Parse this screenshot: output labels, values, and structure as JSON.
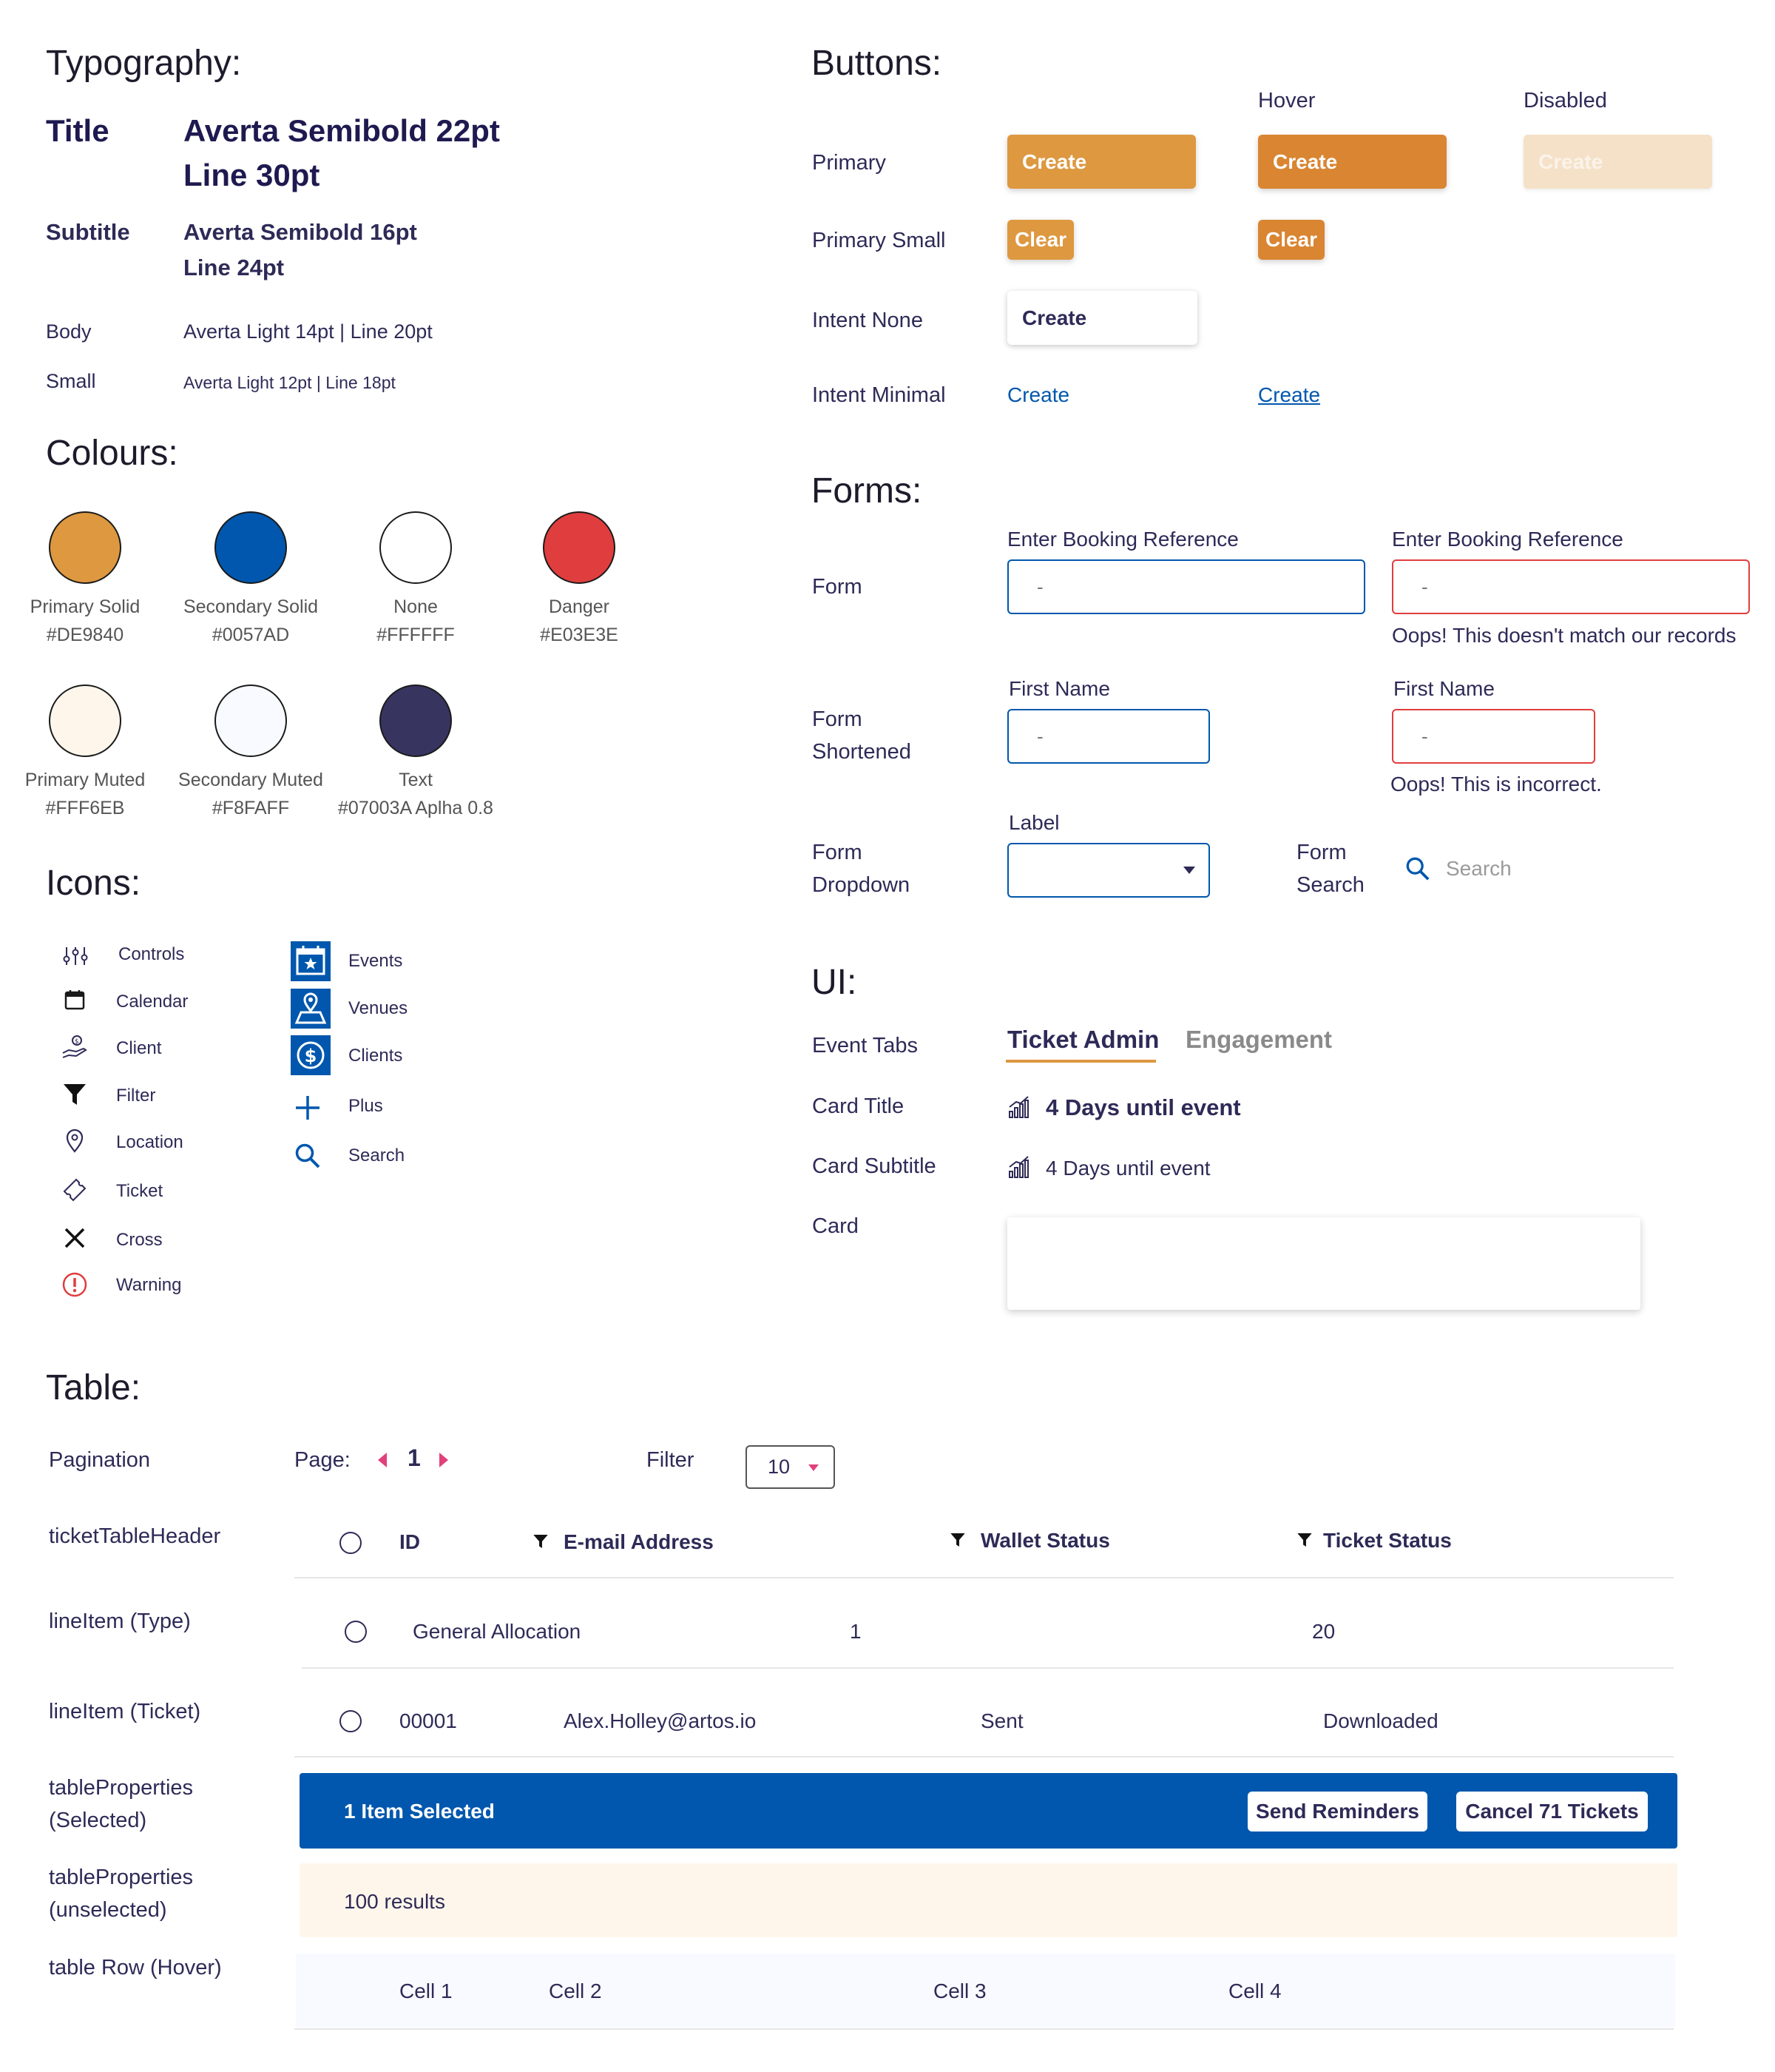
{
  "typography": {
    "heading": "Typography:",
    "title_label": "Title",
    "title_spec_1": "Averta Semibold 22pt",
    "title_spec_2": "Line 30pt",
    "subtitle_label": "Subtitle",
    "subtitle_spec_1": "Averta Semibold 16pt",
    "subtitle_spec_2": "Line 24pt",
    "body_label": "Body",
    "body_spec": "Averta Light 14pt | Line 20pt",
    "small_label": "Small",
    "small_spec": "Averta Light 12pt | Line 18pt"
  },
  "colours": {
    "heading": "Colours:",
    "swatches": [
      {
        "name": "Primary Solid",
        "hex": "#DE9840",
        "color": "#DE9840"
      },
      {
        "name": "Secondary Solid",
        "hex": "#0057AD",
        "color": "#0057AD"
      },
      {
        "name": "None",
        "hex": "#FFFFFF",
        "color": "#FFFFFF"
      },
      {
        "name": "Danger",
        "hex": "#E03E3E",
        "color": "#E03E3E"
      },
      {
        "name": "Primary Muted",
        "hex": "#FFF6EB",
        "color": "#FFF6EB"
      },
      {
        "name": "Secondary Muted",
        "hex": "#F8FAFF",
        "color": "#F8FAFF"
      },
      {
        "name": "Text",
        "hex": "#07003A Aplha 0.8",
        "color": "#383460"
      }
    ]
  },
  "icons": {
    "heading": "Icons:",
    "list_a": [
      {
        "label": "Controls",
        "icon": "controls-icon"
      },
      {
        "label": "Calendar",
        "icon": "calendar-icon"
      },
      {
        "label": "Client",
        "icon": "client-icon"
      },
      {
        "label": "Filter",
        "icon": "filter-icon"
      },
      {
        "label": "Location",
        "icon": "location-icon"
      },
      {
        "label": "Ticket",
        "icon": "ticket-icon"
      },
      {
        "label": "Cross",
        "icon": "cross-icon"
      },
      {
        "label": "Warning",
        "icon": "warning-icon"
      }
    ],
    "list_b": [
      {
        "label": "Events",
        "icon": "events-icon"
      },
      {
        "label": "Venues",
        "icon": "venues-icon"
      },
      {
        "label": "Clients",
        "icon": "clients-icon"
      },
      {
        "label": "Plus",
        "icon": "plus-icon"
      },
      {
        "label": "Search",
        "icon": "search-icon"
      }
    ]
  },
  "buttons": {
    "heading": "Buttons:",
    "col_hover": "Hover",
    "col_disabled": "Disabled",
    "row_primary": "Primary",
    "row_primary_small": "Primary Small",
    "row_intent_none": "Intent None",
    "row_intent_minimal": "Intent Minimal",
    "create": "Create",
    "clear": "Clear",
    "colors": {
      "primary": "#DE9840",
      "hover": "#D98532",
      "disabled": "#F5E1C8",
      "link": "#0057AD"
    }
  },
  "forms": {
    "heading": "Forms:",
    "form_label": "Form",
    "booking_label": "Enter Booking Reference",
    "placeholder": "-",
    "booking_error": "Oops! This doesn't match our records",
    "shortened_label_1": "Form",
    "shortened_label_2": "Shortened",
    "first_name_label": "First Name",
    "first_name_error": "Oops! This is incorrect.",
    "dropdown_label_1": "Form",
    "dropdown_label_2": "Dropdown",
    "dropdown_field_label": "Label",
    "search_label_1": "Form",
    "search_label_2": "Search",
    "search_placeholder": "Search"
  },
  "ui": {
    "heading": "UI:",
    "event_tabs_label": "Event Tabs",
    "tab_active": "Ticket Admin",
    "tab_inactive": "Engagement",
    "card_title_label": "Card Title",
    "card_title_text": "4 Days until event",
    "card_subtitle_label": "Card Subtitle",
    "card_subtitle_text": "4 Days until event",
    "card_label": "Card"
  },
  "table": {
    "heading": "Table:",
    "pagination_label": "Pagination",
    "page_label": "Page:",
    "page_number": "1",
    "filter_label": "Filter",
    "filter_value": "10",
    "header_label": "ticketTableHeader",
    "headers": [
      "ID",
      "E-mail Address",
      "Wallet Status",
      "Ticket Status"
    ],
    "line_type_label": "lineItem (Type)",
    "line_type": {
      "name": "General Allocation",
      "count": "1",
      "total": "20"
    },
    "line_ticket_label": "lineItem (Ticket)",
    "line_ticket": {
      "id": "00001",
      "email": "Alex.Holley@artos.io",
      "wallet": "Sent",
      "ticket": "Downloaded"
    },
    "selected_label_1": "tableProperties",
    "selected_label_2": "(Selected)",
    "selected_text": "1 Item Selected",
    "send_reminders": "Send Reminders",
    "cancel_tickets": "Cancel 71 Tickets",
    "unselected_label_1": "tableProperties",
    "unselected_label_2": "(unselected)",
    "results_text": "100 results",
    "hover_label": "table Row (Hover)",
    "hover_cells": [
      "Cell 1",
      "Cell 2",
      "Cell 3",
      "Cell 4"
    ]
  }
}
